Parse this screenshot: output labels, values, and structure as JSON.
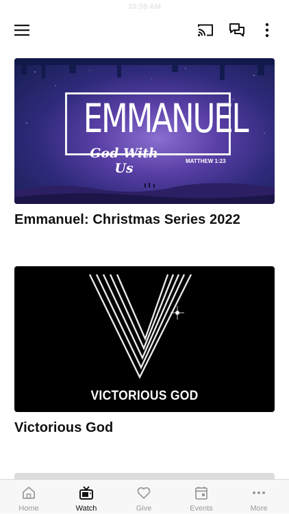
{
  "status": {
    "time": "10:59 AM"
  },
  "header": {
    "menu_icon": "hamburger-menu-icon",
    "cast_icon": "cast-icon",
    "chat_icon": "chat-bubbles-icon",
    "more_icon": "vertical-dots-icon"
  },
  "media": [
    {
      "title": "Emmanuel: Christmas Series 2022",
      "art": {
        "word": "EMMANUEL",
        "subtitle": "God With Us",
        "verse": "MATTHEW 1:23"
      }
    },
    {
      "title": "Victorious God",
      "art": {
        "word": "VICTORIOUS GOD"
      }
    }
  ],
  "tabs": [
    {
      "label": "Home",
      "icon": "home-icon",
      "active": false
    },
    {
      "label": "Watch",
      "icon": "tv-icon",
      "active": true
    },
    {
      "label": "Give",
      "icon": "heart-icon",
      "active": false
    },
    {
      "label": "Events",
      "icon": "calendar-icon",
      "active": false
    },
    {
      "label": "More",
      "icon": "horizontal-dots-icon",
      "active": false
    }
  ],
  "colors": {
    "active_tab": "#111111",
    "inactive_tab": "#9a9a9a",
    "tabbar_bg": "#f7f7f7"
  }
}
